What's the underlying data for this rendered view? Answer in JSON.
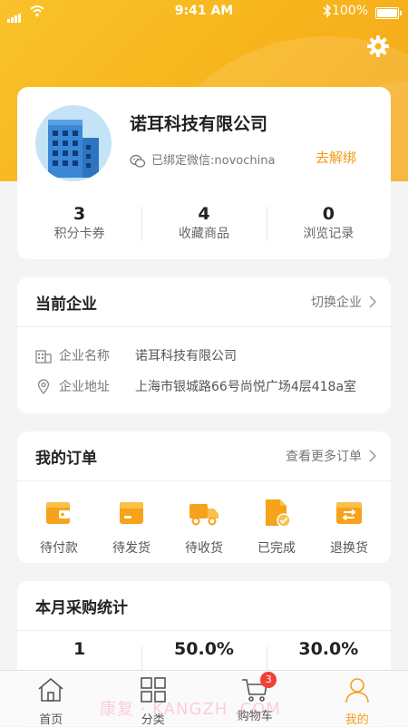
{
  "status_bar": {
    "time": "9:41 AM",
    "battery": "100%"
  },
  "profile": {
    "company_name": "诺耳科技有限公司",
    "wechat_text": "已绑定微信:novochina",
    "unbind_label": "去解绑",
    "stats": [
      {
        "value": "3",
        "label": "积分卡券"
      },
      {
        "value": "4",
        "label": "收藏商品"
      },
      {
        "value": "0",
        "label": "浏览记录"
      }
    ]
  },
  "current_company": {
    "title": "当前企业",
    "switch_label": "切换企业",
    "name_label": "企业名称",
    "name_value": "诺耳科技有限公司",
    "address_label": "企业地址",
    "address_value": "上海市银城路66号尚悦广场4层418a室"
  },
  "orders": {
    "title": "我的订单",
    "more_label": "查看更多订单",
    "items": [
      {
        "label": "待付款",
        "icon": "wallet-icon"
      },
      {
        "label": "待发货",
        "icon": "package-icon"
      },
      {
        "label": "待收货",
        "icon": "truck-icon"
      },
      {
        "label": "已完成",
        "icon": "document-check-icon"
      },
      {
        "label": "退换货",
        "icon": "exchange-icon"
      }
    ]
  },
  "purchase_stats": {
    "title": "本月采购统计",
    "values": [
      "1",
      "50.0%",
      "30.0%"
    ]
  },
  "tabbar": {
    "items": [
      {
        "label": "首页",
        "icon": "home-icon"
      },
      {
        "label": "分类",
        "icon": "category-icon"
      },
      {
        "label": "购物车",
        "icon": "cart-icon",
        "badge": "3"
      },
      {
        "label": "我的",
        "icon": "user-icon",
        "active": true
      }
    ]
  },
  "watermark": "康复 · KANGZH .COM",
  "colors": {
    "accent": "#f5a01a",
    "badge": "#f04134",
    "hero": "#f7b51c"
  }
}
